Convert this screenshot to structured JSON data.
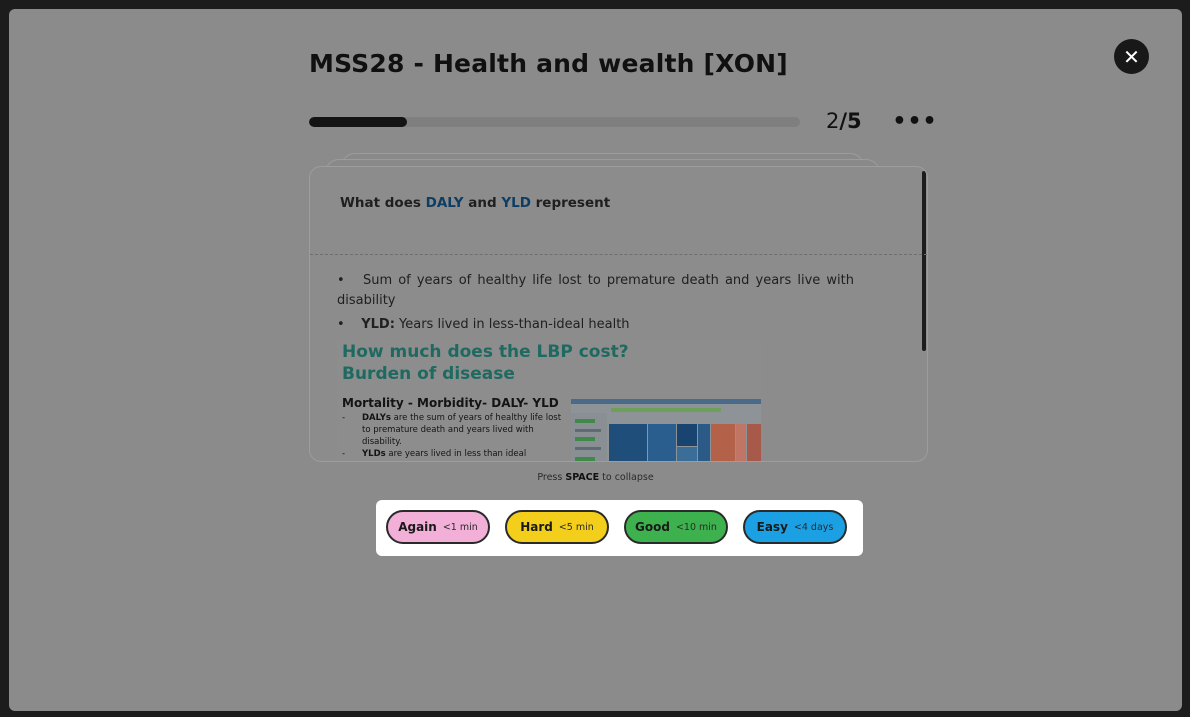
{
  "deck": {
    "title": "MSS28 - Health and wealth [XON]"
  },
  "progress": {
    "current": "2",
    "separator": "/",
    "total": "5",
    "fraction": 0.2
  },
  "icons": {
    "close": "close-icon",
    "more": "more-horizontal-icon"
  },
  "card": {
    "question": {
      "pre": "What  does",
      "term1": "DALY",
      "mid": "and",
      "term2": "YLD",
      "post": "represent"
    },
    "answer": {
      "bullet1_text": "Sum  of  years  of  healthy  life  lost  to  premature  death  and  years  live  with disability",
      "bullet2_term": "YLD:",
      "bullet2_text": "Years lived in less-than-ideal health"
    },
    "slide": {
      "heading1": "How much does the LBP cost?",
      "heading2": "Burden of disease",
      "subheading": "Mortality - Morbidity- DALY- YLD",
      "items": [
        {
          "term": "DALYs",
          "text": "are the sum of years of healthy life lost to premature death and years lived with disability."
        },
        {
          "term": "YLDs",
          "text": "are years lived in less than ideal"
        }
      ]
    }
  },
  "hint": {
    "pre": "Press",
    "key": "SPACE",
    "post": "to collapse"
  },
  "grades": [
    {
      "label": "Again",
      "time": "<1 min",
      "color": "#f2afd8"
    },
    {
      "label": "Hard",
      "time": "<5 min",
      "color": "#f3cf1b"
    },
    {
      "label": "Good",
      "time": "<10 min",
      "color": "#3eb14f"
    },
    {
      "label": "Easy",
      "time": "<4 days",
      "color": "#1ba1e3"
    }
  ],
  "colors": {
    "overlay": "#8b8b8b",
    "accent_term": "#0e3d63",
    "slide_heading": "#1e6a60"
  }
}
